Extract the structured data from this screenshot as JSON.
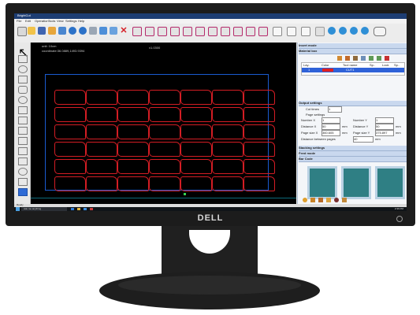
{
  "app": {
    "title": "BrightCut",
    "menu": [
      "File",
      "Edit",
      "Operation",
      "Tools",
      "View",
      "Settings",
      "Help"
    ],
    "toolbar_icons": [
      "new-file-icon",
      "open-icon",
      "save-icon",
      "import-icon",
      "export-icon",
      "undo-icon",
      "redo-icon",
      "cut-icon",
      "copy-icon",
      "paste-icon",
      "delete-icon",
      "align-icon",
      "mirror-icon",
      "rotate-icon",
      "group-icon",
      "ungroup-icon",
      "zoom-icon",
      "fit-icon",
      "settings-icon",
      "preview-icon",
      "start-icon"
    ]
  },
  "canvas": {
    "unit_text": "unit: 10cm",
    "coord_text": "coordinate:36.0889,1493.9394",
    "version": "v1.0300",
    "rows": 6,
    "cols": 7,
    "shape_color": "#d41d24"
  },
  "panel": {
    "insert_mode": "Insert mode",
    "material_box": "Material box",
    "table_headers": [
      "Lay..",
      "Color",
      "Tool name",
      "Sp..",
      "Lock",
      "Sp.."
    ],
    "table_row": [
      "1",
      "",
      "CUT1",
      "",
      "",
      ""
    ],
    "output_settings": "Output settings",
    "cut_times_label": "Cut times",
    "cut_times_value": "1",
    "page_settings": "Page settings",
    "number_x_label": "Number X",
    "number_x_value": "1",
    "number_y_label": "Number Y",
    "number_y_value": "1",
    "distance_x_label": "Distance X",
    "distance_x_value": "50",
    "distance_y_label": "Distance Y",
    "distance_y_value": "50",
    "page_size_x_label": "Page size X",
    "page_size_x_value": "360.605",
    "page_size_y_label": "Page size Y",
    "page_size_y_value": "375.897",
    "unit_mm": "mm",
    "distance_pages_label": "Distance between pages",
    "distance_pages_value": "40",
    "stacking_settings": "Stacking settings",
    "feed_mode": "Feed mode",
    "bar_code": "Bar Code"
  },
  "status": {
    "ready": "Ready",
    "search_placeholder": "Ask me anything",
    "time": "2:36 PM"
  },
  "monitor": {
    "brand": "DELL"
  }
}
